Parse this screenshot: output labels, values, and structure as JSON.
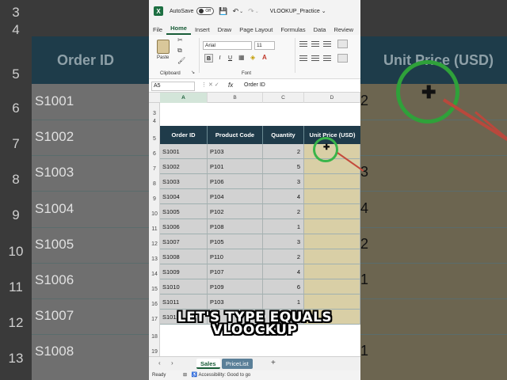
{
  "background": {
    "row_numbers": [
      "3",
      "4",
      "5",
      "6",
      "7",
      "8",
      "9",
      "10",
      "11",
      "12",
      "13"
    ],
    "headers": [
      "Order ID",
      "Unit Price (USD)"
    ],
    "order_ids": [
      "S1001",
      "S1002",
      "S1003",
      "S1004",
      "S1005",
      "S1006",
      "S1007",
      "S1008"
    ],
    "right_digits": [
      "2",
      "",
      "3",
      "4",
      "2",
      "1",
      "",
      "1"
    ]
  },
  "titlebar": {
    "app_logo": "X",
    "autosave_label": "AutoSave",
    "autosave_state": "Off",
    "doc_name": "VLOOKUP_Practice ⌄"
  },
  "menu": [
    "File",
    "Home",
    "Insert",
    "Draw",
    "Page Layout",
    "Formulas",
    "Data",
    "Review"
  ],
  "ribbon": {
    "paste_label": "Paste",
    "clipboard_label": "Clipboard",
    "font_name": "Arial",
    "font_size": "11",
    "font_label": "Font",
    "bold": "B",
    "italic": "I",
    "underline": "U"
  },
  "formula_bar": {
    "name_box": "A5",
    "fx": "fx",
    "content": "Order ID"
  },
  "columns": [
    "A",
    "B",
    "C",
    "D"
  ],
  "rows": [
    "3",
    "4",
    "5",
    "6",
    "7",
    "8",
    "9",
    "10",
    "11",
    "12",
    "13",
    "14",
    "15",
    "16",
    "17",
    "18",
    "19"
  ],
  "table": {
    "headers": [
      "Order ID",
      "Product Code",
      "Quantity",
      "Unit Price (USD)"
    ],
    "rows": [
      {
        "order_id": "S1001",
        "product_code": "P103",
        "quantity": "2"
      },
      {
        "order_id": "S1002",
        "product_code": "P101",
        "quantity": "5"
      },
      {
        "order_id": "S1003",
        "product_code": "P106",
        "quantity": "3"
      },
      {
        "order_id": "S1004",
        "product_code": "P104",
        "quantity": "4"
      },
      {
        "order_id": "S1005",
        "product_code": "P102",
        "quantity": "2"
      },
      {
        "order_id": "S1006",
        "product_code": "P108",
        "quantity": "1"
      },
      {
        "order_id": "S1007",
        "product_code": "P105",
        "quantity": "3"
      },
      {
        "order_id": "S1008",
        "product_code": "P110",
        "quantity": "2"
      },
      {
        "order_id": "S1009",
        "product_code": "P107",
        "quantity": "4"
      },
      {
        "order_id": "S1010",
        "product_code": "P109",
        "quantity": "6"
      },
      {
        "order_id": "S1011",
        "product_code": "P103",
        "quantity": "1"
      },
      {
        "order_id": "S1012",
        "product_code": "",
        "quantity": ""
      }
    ]
  },
  "sheet_tabs": {
    "tabs": [
      "Sales",
      "PriceList"
    ],
    "active": "Sales",
    "add": "+"
  },
  "status": {
    "ready": "Ready",
    "accessibility": "Accessibility: Good to go"
  },
  "caption": {
    "line1": "LET'S TYPE EQUALS",
    "line2": "VLOOCKUP"
  },
  "colors": {
    "excel_green": "#185c37",
    "header_band": "#1f3b4a",
    "gray_cells": "#d2d2d2",
    "tan_cells": "#d9cfa6",
    "highlight_ring": "#39b54a",
    "annotation_stroke": "#c44b3c"
  }
}
